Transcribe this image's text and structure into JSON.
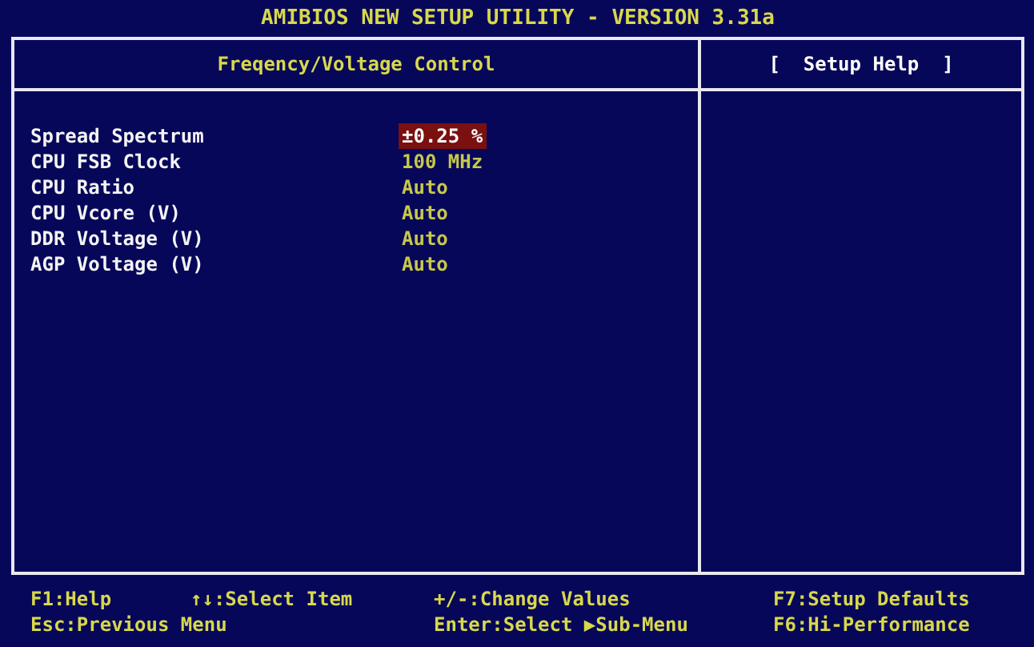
{
  "window": {
    "title": "AMIBIOS NEW SETUP UTILITY - VERSION 3.31a"
  },
  "panel": {
    "title": "Freqency/Voltage Control"
  },
  "help_panel": {
    "title": "[  Setup Help  ]"
  },
  "settings": [
    {
      "label": "Spread Spectrum",
      "value": "±0.25 %",
      "selected": true
    },
    {
      "label": "CPU FSB Clock",
      "value": "100 MHz",
      "selected": false
    },
    {
      "label": "CPU Ratio",
      "value": "Auto",
      "selected": false
    },
    {
      "label": "CPU Vcore (V)",
      "value": "Auto",
      "selected": false
    },
    {
      "label": "DDR Voltage (V)",
      "value": "Auto",
      "selected": false
    },
    {
      "label": "AGP Voltage (V)",
      "value": "Auto",
      "selected": false
    }
  ],
  "key_hints": [
    [
      "F1:Help",
      "↑↓:Select Item",
      "+/-:Change Values",
      "F7:Setup Defaults"
    ],
    [
      "Esc:Previous Menu",
      "Enter:Select ▶Sub-Menu",
      "F6:Hi-Performance"
    ]
  ]
}
